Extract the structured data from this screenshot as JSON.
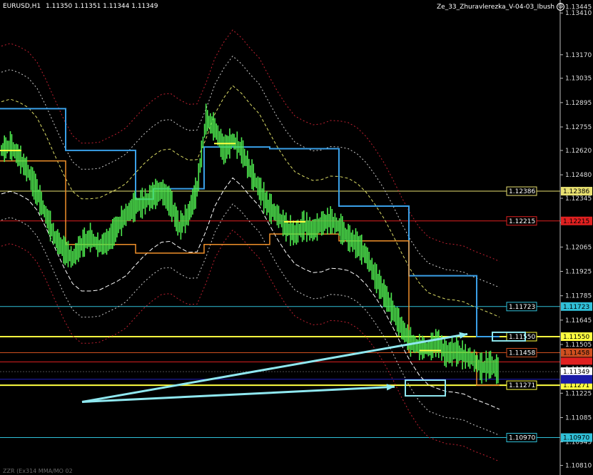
{
  "header": {
    "symbol": "EURUSD,H1",
    "ohlc": "1.11350 1.11351 1.11344 1.11349",
    "indicator_title": "Ze_33_Zhuravlerezka_V-04-03_Ibush",
    "smile_icon": "smile-icon"
  },
  "footer_text": "ZZR (Ex314 MMA/MO 02",
  "chart_data": {
    "type": "line",
    "ylim": [
      1.108,
      1.1346
    ],
    "y_ticks": [
      "1.13445",
      "1.13410",
      "1.13170",
      "1.13035",
      "1.12895",
      "1.12755",
      "1.12620",
      "1.12480",
      "1.12345",
      "1.12205",
      "1.12065",
      "1.11925",
      "1.11785",
      "1.11645",
      "1.11505",
      "1.11365",
      "1.11225",
      "1.11085",
      "1.10945",
      "1.10810"
    ],
    "h_levels": [
      {
        "label": "1.12386",
        "value": 1.12386,
        "color": "#e8e070"
      },
      {
        "label": "1.12215",
        "value": 1.12215,
        "color": "#e02020"
      },
      {
        "label": "1.11723",
        "value": 1.11723,
        "color": "#30c0d8"
      },
      {
        "label": "1.11550",
        "value": 1.1155,
        "color": "#ffff40"
      },
      {
        "label": "1.11458",
        "value": 1.11458,
        "color": "#d05020"
      },
      {
        "label": "1.11271",
        "value": 1.11271,
        "color": "#ffff40"
      },
      {
        "label": "1.10970",
        "value": 1.1097,
        "color": "#30c0d8"
      }
    ],
    "current_price": {
      "label": "1.11349",
      "value": 1.11349
    },
    "series": [
      {
        "values": [
          1.1262,
          1.1265,
          1.1258,
          1.125,
          1.1238,
          1.1225,
          1.1212,
          1.1205,
          1.12,
          1.1208,
          1.1212,
          1.1207,
          1.121,
          1.1218,
          1.1225,
          1.123,
          1.1232,
          1.1236,
          1.1239,
          1.1232,
          1.1218,
          1.1225,
          1.124,
          1.128,
          1.1275,
          1.1262,
          1.1268,
          1.1262,
          1.125,
          1.124,
          1.123,
          1.1225,
          1.1218,
          1.1214,
          1.1219,
          1.1216,
          1.122,
          1.1222,
          1.1218,
          1.1212,
          1.1208,
          1.1202,
          1.119,
          1.118,
          1.117,
          1.116,
          1.1152,
          1.1149,
          1.1148,
          1.1152,
          1.1145,
          1.1147,
          1.1144,
          1.1142,
          1.1137,
          1.1139,
          1.1135
        ]
      }
    ]
  }
}
